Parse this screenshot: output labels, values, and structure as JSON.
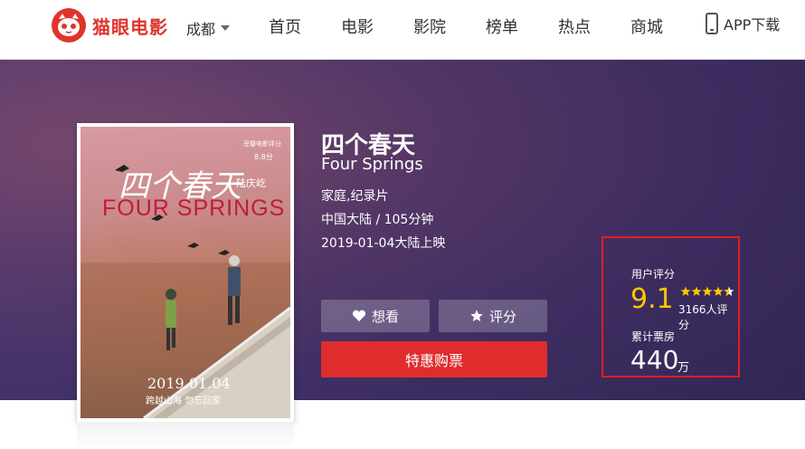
{
  "brand": {
    "name": "猫眼电影",
    "color": "#e0342b"
  },
  "header": {
    "city": "成都",
    "nav": [
      "首页",
      "电影",
      "影院",
      "榜单",
      "热点",
      "商城"
    ],
    "app_download": "APP下载"
  },
  "poster": {
    "title_cn": "四个春天",
    "title_en": "FOUR SPRINGS",
    "director": "陆庆屹",
    "date": "2019.01.04",
    "tagline": "跨越山海 勿忘回家",
    "award_line1": "豆瓣电影评分",
    "award_score": "8.8分"
  },
  "movie": {
    "title_cn": "四个春天",
    "title_en": "Four Springs",
    "genres": "家庭,纪录片",
    "region_duration": "中国大陆 / 105分钟",
    "release": "2019-01-04大陆上映"
  },
  "actions": {
    "want_label": "想看",
    "rate_label": "评分",
    "buy_label": "特惠购票",
    "buy_color": "#df2d2d"
  },
  "rating": {
    "user_label": "用户评分",
    "score": "9.1",
    "stars": 4.5,
    "count": "3166人评分",
    "box_office_label": "累计票房",
    "box_office": "440",
    "box_office_unit": "万",
    "score_color": "#ffc600"
  }
}
